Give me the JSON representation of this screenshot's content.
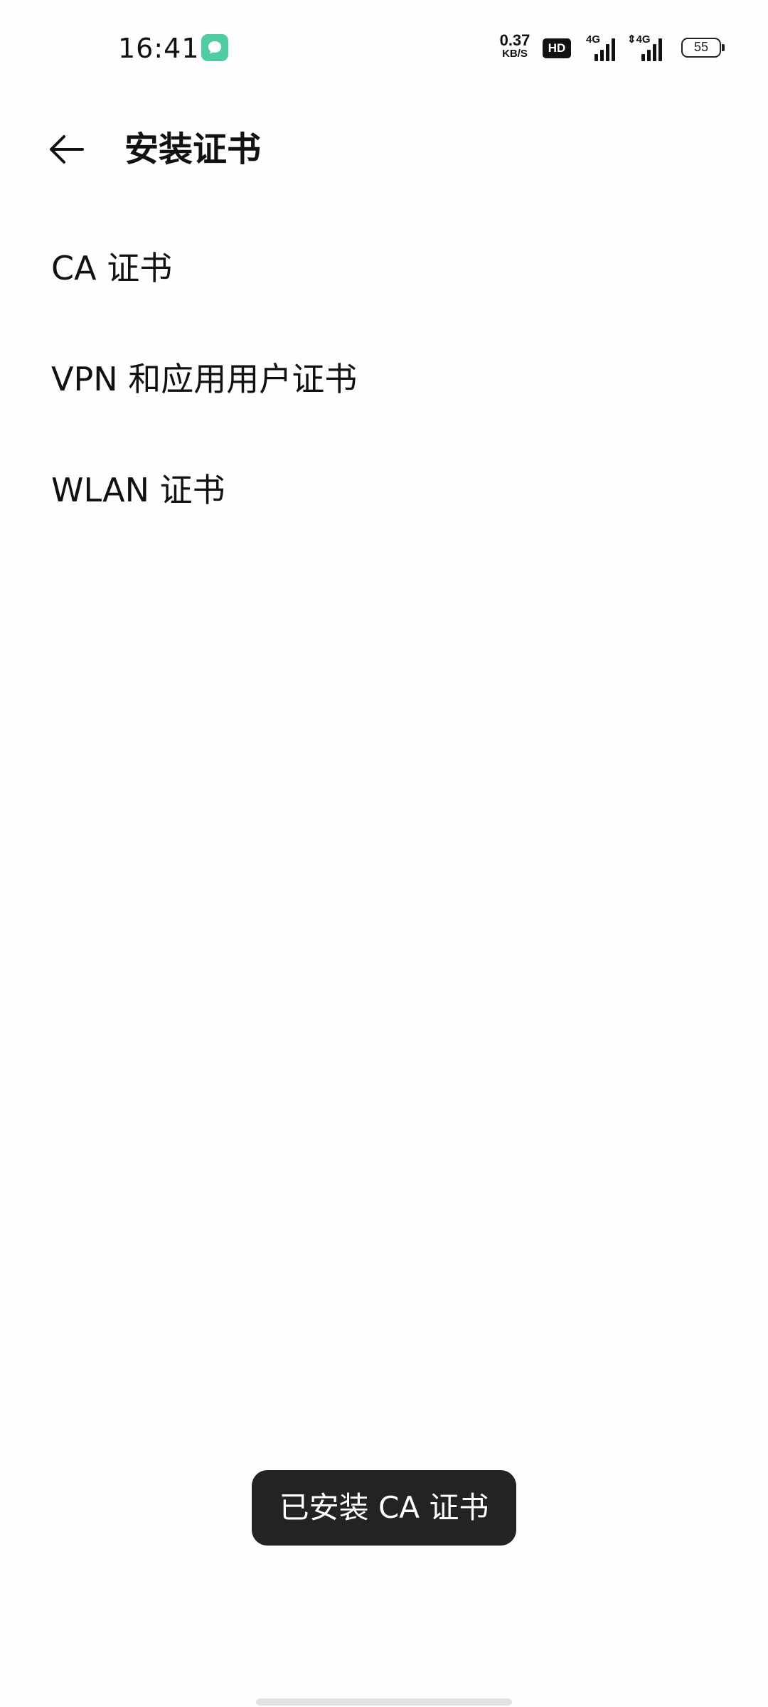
{
  "status_bar": {
    "time": "16:41",
    "notification_icon": "chat-bubble-icon",
    "net_speed_value": "0.37",
    "net_speed_unit": "KB/S",
    "hd_badge": "HD",
    "signal_1_label": "4G",
    "signal_2_label": "⇕4G",
    "battery_level": "55"
  },
  "app_bar": {
    "back_icon": "arrow-left-icon",
    "title": "安装证书"
  },
  "cert_list": {
    "items": [
      {
        "label": "CA 证书"
      },
      {
        "label": "VPN 和应用用户证书"
      },
      {
        "label": "WLAN 证书"
      }
    ]
  },
  "toast": {
    "message": "已安装 CA 证书"
  },
  "colors": {
    "background": "#fefefe",
    "text": "#111111",
    "toast_background": "#232323",
    "notification_icon": "#4fcca0"
  }
}
